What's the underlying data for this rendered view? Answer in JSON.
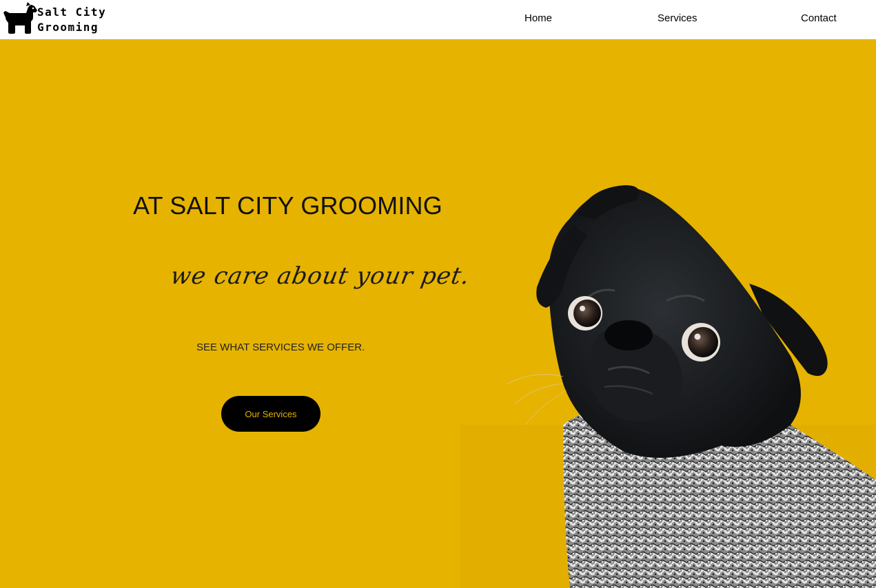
{
  "brand": {
    "name_line1": "Salt City",
    "name_line2": "Grooming",
    "logo_icon": "dog-icon"
  },
  "nav": {
    "items": [
      {
        "label": "Home"
      },
      {
        "label": "Services"
      },
      {
        "label": "Contact"
      }
    ]
  },
  "hero": {
    "title": "AT SALT CITY GROOMING",
    "tagline": "we care about your pet.",
    "subtitle": "SEE WHAT SERVICES WE OFFER.",
    "button_label": "Our Services",
    "image": "pug-in-sweater-photo"
  },
  "colors": {
    "hero_background": "#e6b300",
    "button_background": "#000000",
    "button_text": "#e6b300"
  }
}
